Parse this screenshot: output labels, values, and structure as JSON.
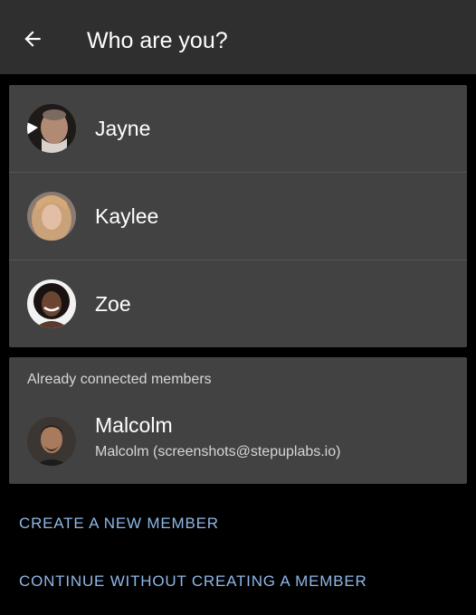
{
  "app_bar": {
    "title": "Who are you?",
    "back_icon": "arrow-back-icon"
  },
  "members": [
    {
      "name": "Jayne",
      "avatar_color": "#6e5a4c"
    },
    {
      "name": "Kaylee",
      "avatar_color": "#b8916a"
    },
    {
      "name": "Zoe",
      "avatar_color": "#4a3428"
    }
  ],
  "connected": {
    "section_label": "Already connected members",
    "items": [
      {
        "name": "Malcolm",
        "subtitle": "Malcolm (screenshots@stepuplabs.io)",
        "avatar_color": "#3a2f2a"
      }
    ]
  },
  "actions": {
    "create_label": "CREATE A NEW MEMBER",
    "continue_label": "CONTINUE WITHOUT CREATING A MEMBER"
  },
  "colors": {
    "background": "#000000",
    "app_bar": "#2f2f2f",
    "card": "#424242",
    "accent_link": "#8fb8e8"
  }
}
